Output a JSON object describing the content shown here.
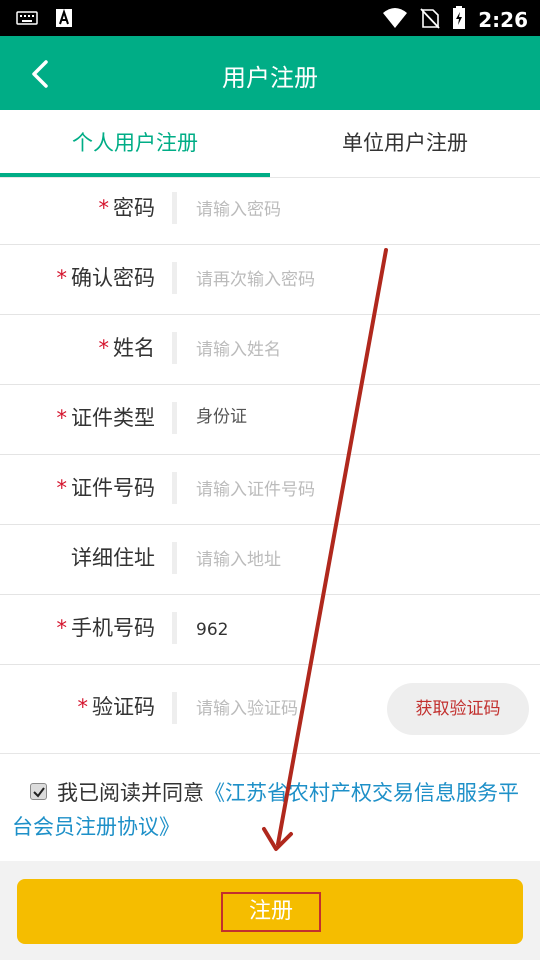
{
  "status_bar": {
    "time": "2:26",
    "left_icons": [
      "keyboard-icon",
      "font-a-icon"
    ],
    "right_icons": [
      "wifi-icon",
      "no-sim-icon",
      "battery-charging-icon"
    ]
  },
  "app_bar": {
    "title": "用户注册",
    "back_icon": "chevron-left-icon"
  },
  "tabs": [
    {
      "label": "个人用户注册",
      "active": true
    },
    {
      "label": "单位用户注册",
      "active": false
    }
  ],
  "form": {
    "rows": [
      {
        "label": "密码",
        "required": "*",
        "placeholder": "请输入密码",
        "value": ""
      },
      {
        "label": "确认密码",
        "required": "*",
        "placeholder": "请再次输入密码",
        "value": ""
      },
      {
        "label": "姓名",
        "required": "*",
        "placeholder": "请输入姓名",
        "value": ""
      },
      {
        "label": "证件类型",
        "required": "*",
        "placeholder": "",
        "value": "身份证"
      },
      {
        "label": "证件号码",
        "required": "*",
        "placeholder": "请输入证件号码",
        "value": ""
      },
      {
        "label": "详细住址",
        "required": "",
        "placeholder": "请输入地址",
        "value": ""
      },
      {
        "label": "手机号码",
        "required": "*",
        "placeholder": "",
        "value": "962"
      },
      {
        "label": "验证码",
        "required": "*",
        "placeholder": "请输入验证码",
        "value": ""
      }
    ],
    "get_code_label": "获取验证码"
  },
  "agreement": {
    "checked": true,
    "text": "我已阅读并同意",
    "link_text": "《江苏省农村产权交易信息服务平台会员注册协议》"
  },
  "submit": {
    "label": "注册"
  },
  "colors": {
    "primary": "#00ad86",
    "accent_yellow": "#f5bd00",
    "required_red": "#d5162f",
    "link_blue": "#1e90c8",
    "annotation_red": "#b0281d"
  }
}
